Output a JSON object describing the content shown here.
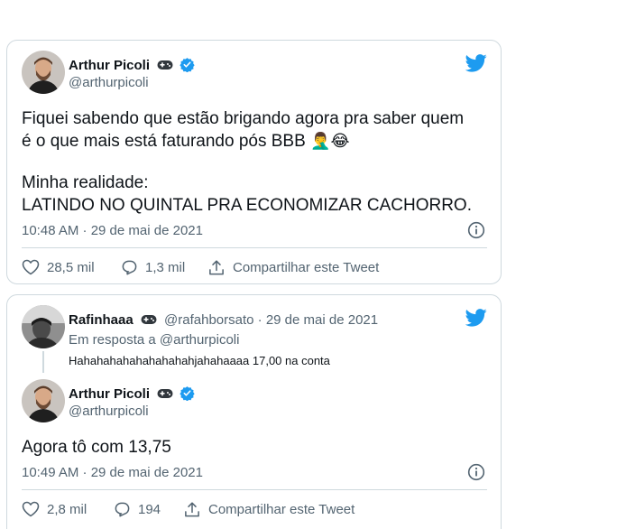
{
  "tweet1": {
    "author_name": "Arthur Picoli",
    "author_handle": "@arthurpicoli",
    "text_line1": "Fiquei sabendo que estão brigando agora pra saber quem",
    "text_line2": "é o que mais está faturando pós BBB",
    "text_line2_emojis": "🤦‍♂️😂",
    "text_line3": "Minha realidade:",
    "text_line4": "LATINDO NO QUINTAL PRA ECONOMIZAR CACHORRO.",
    "time": "10:48 AM · 29 de mai de 2021",
    "likes": "28,5 mil",
    "replies": "1,3 mil",
    "share_label": "Compartilhar este Tweet"
  },
  "tweet2": {
    "reply_name": "Rafinhaaa",
    "reply_handle": "@rafahborsato",
    "reply_date": "· 29 de mai de 2021",
    "in_reply_to": "Em resposta a @arthurpicoli",
    "reply_text": "Hahahahahahahahahahjahahaaaa 17,00 na conta",
    "author_name": "Arthur Picoli",
    "author_handle": "@arthurpicoli",
    "text": "Agora tô com 13,75",
    "time": "10:49 AM · 29 de mai de 2021",
    "likes": "2,8 mil",
    "replies": "194",
    "share_label": "Compartilhar este Tweet"
  },
  "colors": {
    "twitter_blue": "#1d9bf0",
    "text_primary": "#0f1419",
    "text_secondary": "#536471",
    "border": "#cfd9de"
  },
  "icons": [
    "gamepad-icon",
    "verified-badge-icon",
    "twitter-bird-icon",
    "info-icon",
    "heart-icon",
    "reply-icon",
    "share-icon"
  ]
}
